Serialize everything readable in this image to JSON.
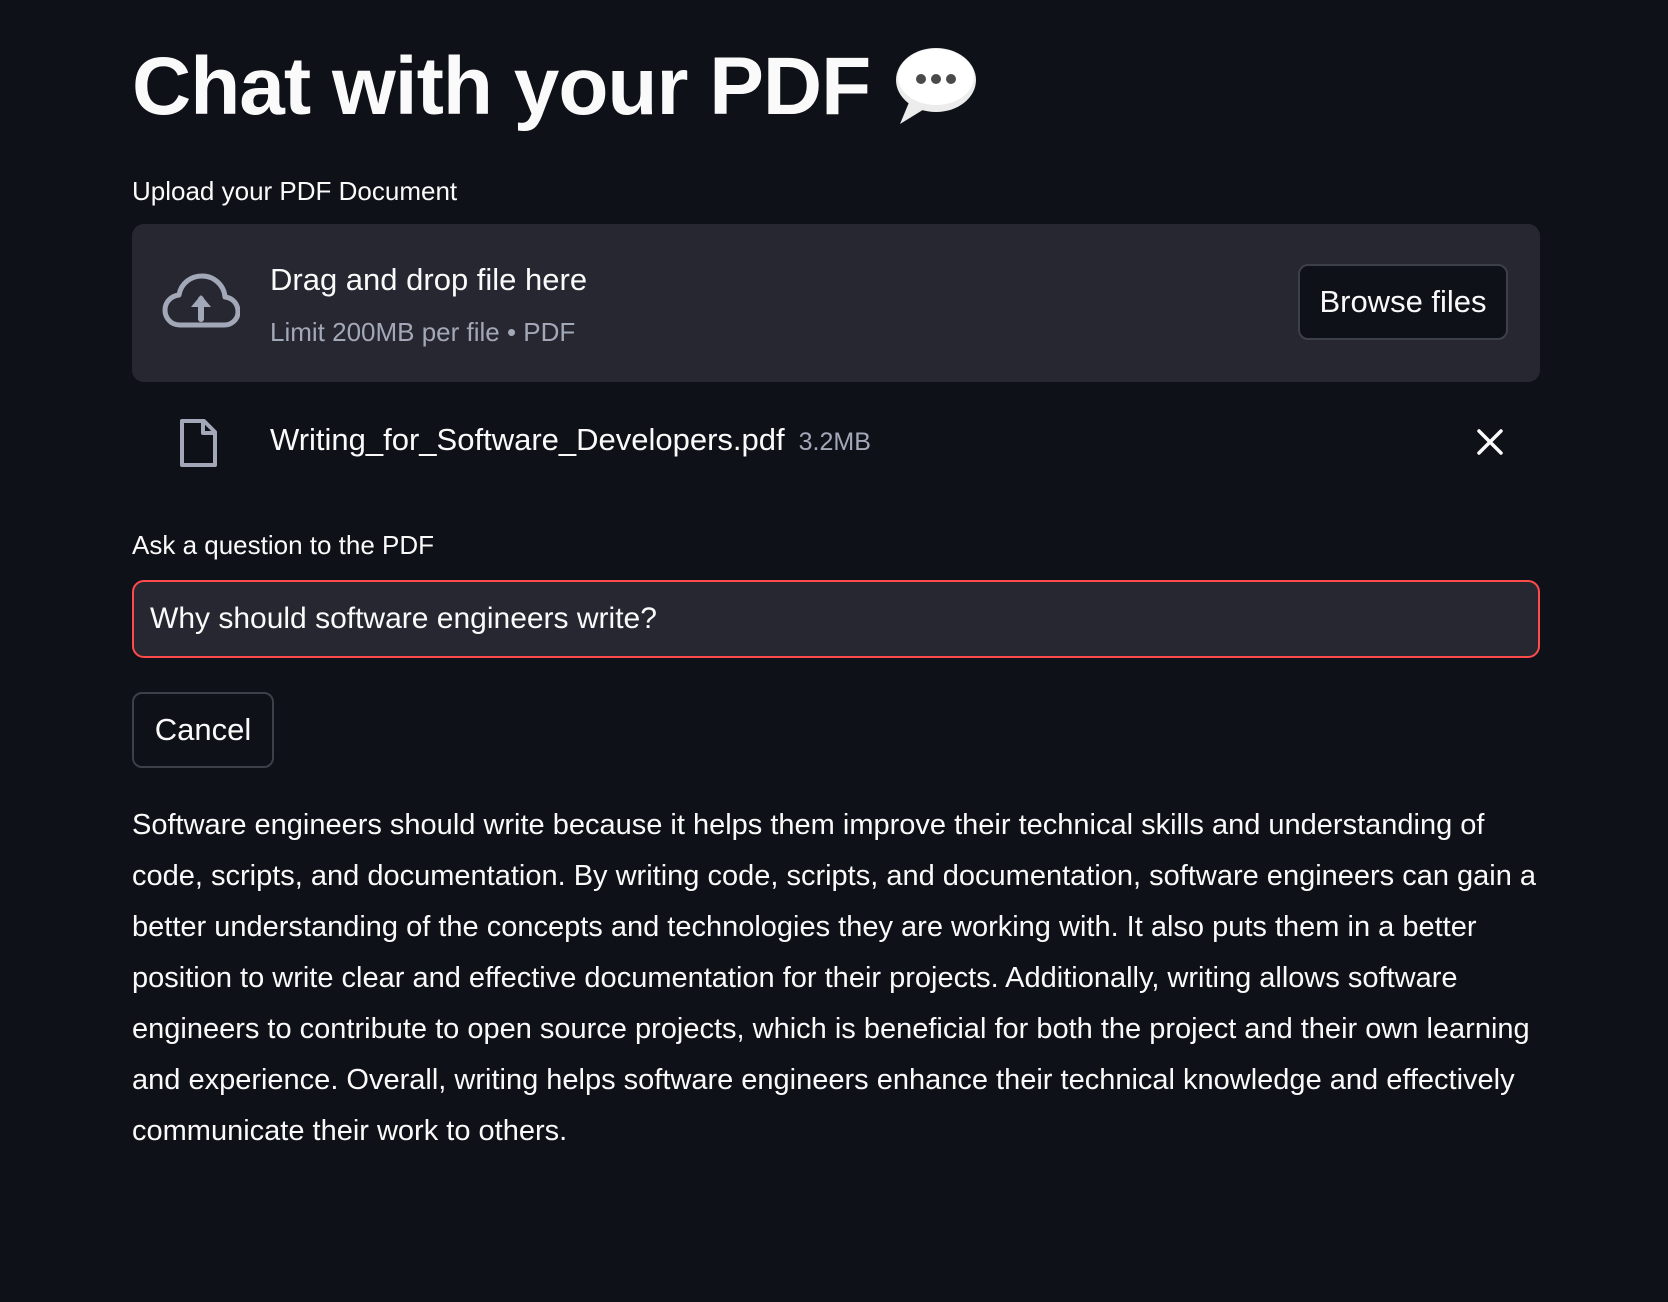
{
  "page": {
    "title": "Chat with your PDF",
    "title_emoji": "speech-balloon-icon"
  },
  "uploader": {
    "label": "Upload your PDF Document",
    "drop_text": "Drag and drop file here",
    "limit_text": "Limit 200MB per file • PDF",
    "browse_label": "Browse files",
    "icon": "cloud-upload-icon"
  },
  "uploaded_file": {
    "name": "Writing_for_Software_Developers.pdf",
    "size": "3.2MB",
    "icon": "file-icon",
    "remove_icon": "close-icon"
  },
  "question": {
    "label": "Ask a question to the PDF",
    "value": "Why should software engineers write?"
  },
  "actions": {
    "cancel_label": "Cancel"
  },
  "answer": {
    "text": "Software engineers should write because it helps them improve their technical skills and understanding of code, scripts, and documentation. By writing code, scripts, and documentation, software engineers can gain a better understanding of the concepts and technologies they are working with. It also puts them in a better position to write clear and effective documentation for their projects. Additionally, writing allows software engineers to contribute to open source projects, which is beneficial for both the project and their own learning and experience. Overall, writing helps software engineers enhance their technical knowledge and effectively communicate their work to others."
  },
  "colors": {
    "background": "#0e1117",
    "surface": "#262730",
    "text": "#fafafa",
    "muted": "#a3a8b8",
    "accent_focus": "#ff4b4b"
  }
}
